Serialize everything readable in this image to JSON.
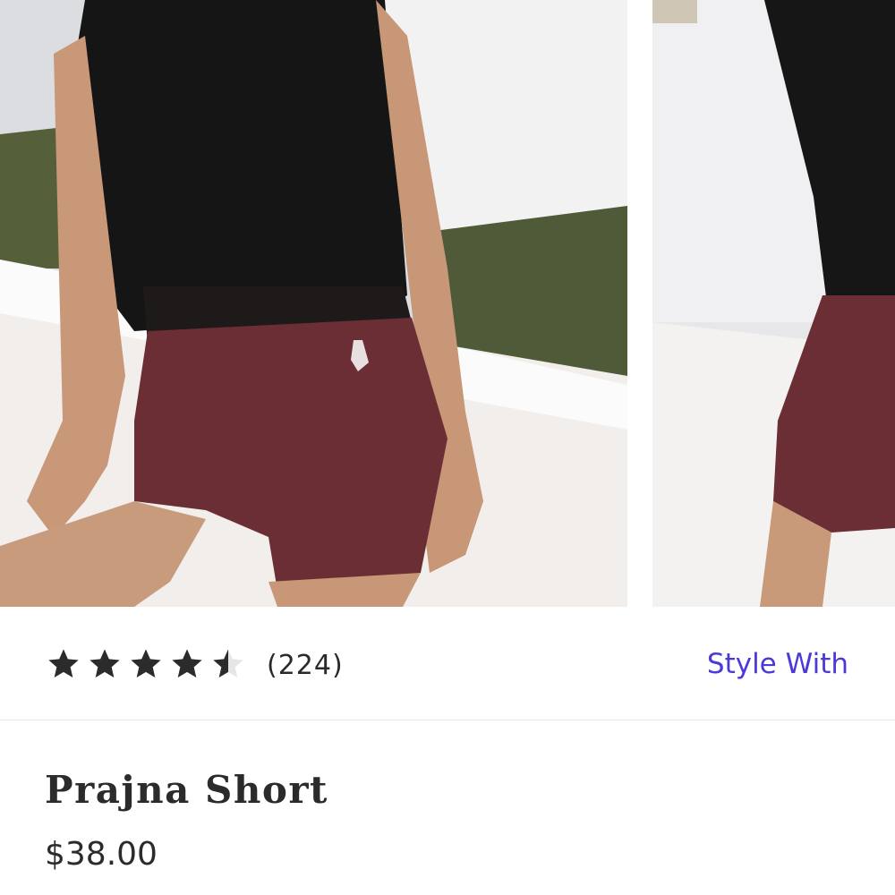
{
  "gallery": {
    "images": [
      {
        "alt": "Model wearing Prajna Short, front view",
        "icon": "product-photo-front"
      },
      {
        "alt": "Model wearing Prajna Short, side view",
        "icon": "product-photo-side"
      }
    ]
  },
  "rating": {
    "value": 4.5,
    "max": 5,
    "count_label": "(224)"
  },
  "style_with_label": "Style With",
  "product": {
    "name": "Prajna Short",
    "price": "$38.00"
  },
  "colors": {
    "accent": "#4a3bd6",
    "short": "#6b2e34",
    "top": "#141414"
  }
}
